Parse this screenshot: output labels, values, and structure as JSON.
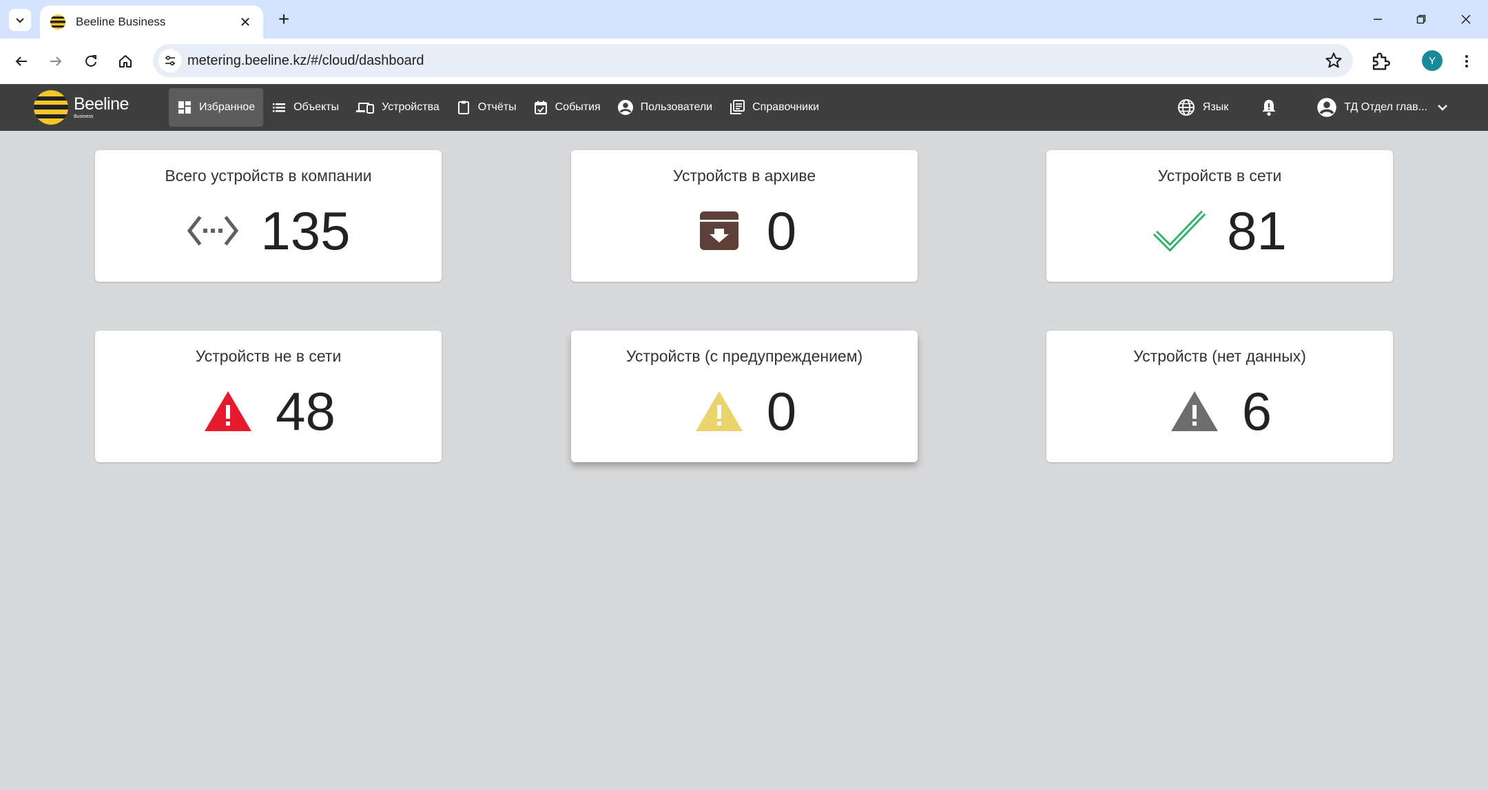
{
  "browser": {
    "tab_title": "Beeline Business",
    "url": "metering.beeline.kz/#/cloud/dashboard",
    "profile_initial": "Y"
  },
  "header": {
    "brand": {
      "name": "Beeline",
      "sub": "Business"
    },
    "menu": [
      {
        "label": "Избранное",
        "icon": "dashboard-icon",
        "active": true
      },
      {
        "label": "Объекты",
        "icon": "list-icon"
      },
      {
        "label": "Устройства",
        "icon": "devices-icon"
      },
      {
        "label": "Отчёты",
        "icon": "clipboard-icon"
      },
      {
        "label": "События",
        "icon": "calendar-check-icon"
      },
      {
        "label": "Пользователи",
        "icon": "account-circle-icon"
      },
      {
        "label": "Справочники",
        "icon": "library-books-icon"
      }
    ],
    "language_label": "Язык",
    "user_label": "ТД Отдел глав..."
  },
  "cards": [
    {
      "title": "Всего устройств в компании",
      "value": "135",
      "icon": "settings-ethernet-icon"
    },
    {
      "title": "Устройств в архиве",
      "value": "0",
      "icon": "archive-icon"
    },
    {
      "title": "Устройств в сети",
      "value": "81",
      "icon": "check-icon"
    },
    {
      "title": "Устройств не в сети",
      "value": "48",
      "icon": "warning-red-icon"
    },
    {
      "title": "Устройств (с предупреждением)",
      "value": "0",
      "icon": "warning-yellow-icon"
    },
    {
      "title": "Устройств (нет данных)",
      "value": "6",
      "icon": "warning-gray-icon"
    }
  ],
  "colors": {
    "brand_yellow": "#f5c629",
    "header_bg": "#3f3f3f",
    "page_bg": "#d8d9da",
    "online_green": "#2fb36c",
    "offline_red": "#e8192c",
    "warning_yellow": "#e9d36c",
    "nodata_gray": "#6e6e6e",
    "archive_brown": "#5d4037"
  }
}
